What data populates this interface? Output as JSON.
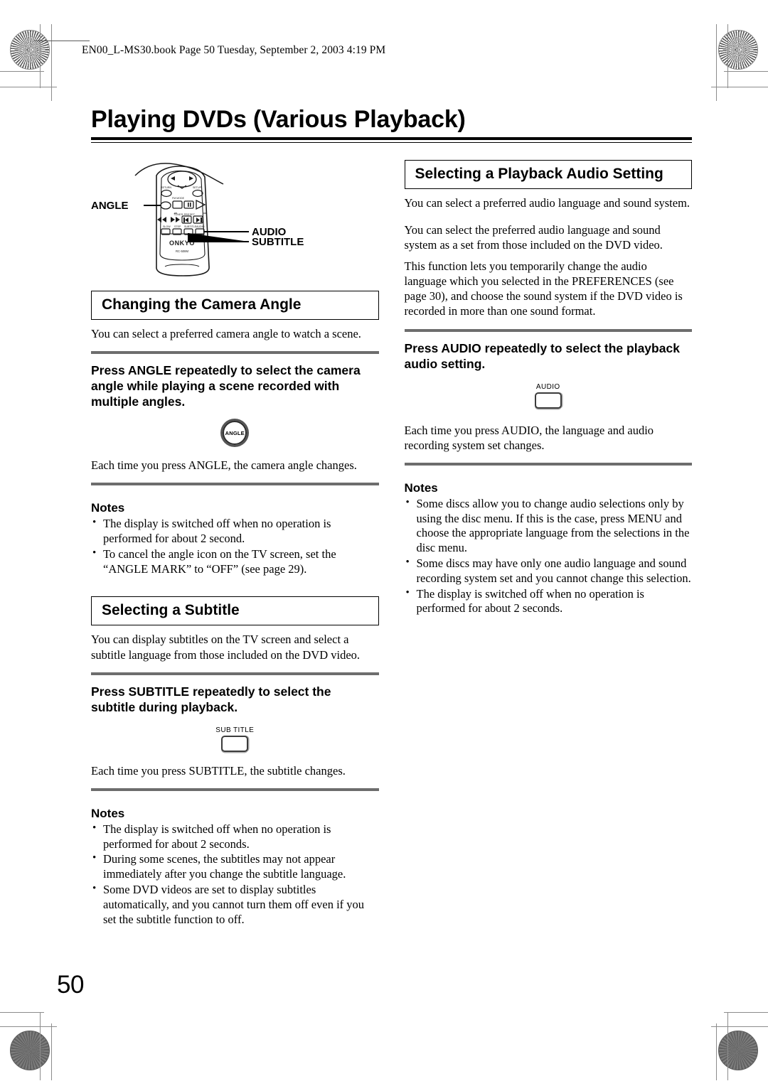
{
  "page": {
    "running_header": "EN00_L-MS30.book  Page 50  Tuesday, September 2, 2003  4:19 PM",
    "title": "Playing DVDs (Various Playback)",
    "page_number": "50"
  },
  "remote_figure": {
    "callout_angle": "ANGLE",
    "callout_audio": "AUDIO",
    "callout_subtitle": "SUBTITLE",
    "brand": "ONKYO",
    "model": "RC-508M",
    "key_labels": {
      "return": "RETURN",
      "setup": "SETUP",
      "fm_mode": "FM MODE",
      "tuner_preset": "TUNER PRESET",
      "slow": "SLOW",
      "step": "STEP",
      "subtitle": "SUBTITLE",
      "audio": "AUDIO"
    }
  },
  "left_column": {
    "angle_section": {
      "heading": "Changing the Camera Angle",
      "intro": "You can select a preferred camera angle to watch a scene.",
      "instruction": "Press ANGLE repeatedly to select the camera angle while playing a scene recorded with multiple angles.",
      "button_icon_label": "ANGLE",
      "result": "Each time you press ANGLE, the camera angle changes.",
      "notes_heading": "Notes",
      "notes": [
        "The display is switched off when no operation is performed for about 2 second.",
        "To cancel the angle icon on the TV screen, set the “ANGLE MARK” to “OFF” (see page 29)."
      ]
    },
    "subtitle_section": {
      "heading": "Selecting a Subtitle",
      "intro": "You can display subtitles on the TV screen and select a subtitle language from those included on the DVD video.",
      "instruction": "Press SUBTITLE repeatedly to select the subtitle during playback.",
      "indicator_label": "SUB TITLE",
      "result": "Each time you press SUBTITLE, the subtitle changes.",
      "notes_heading": "Notes",
      "notes": [
        "The display is switched off when no operation is performed for about 2 seconds.",
        "During some scenes, the subtitles may not appear immediately after you change the subtitle language.",
        "Some DVD videos are set to display subtitles automatically, and you cannot turn them off even if you set the subtitle function to off."
      ]
    }
  },
  "right_column": {
    "audio_section": {
      "heading": "Selecting a Playback Audio Setting",
      "intro": "You can select a preferred audio language and sound system.",
      "paragraph_2": "You can select the preferred audio language and sound system as a set from those included on the DVD video.",
      "paragraph_3": "This function lets you temporarily change the audio language which you selected in the PREFERENCES (see page 30), and choose the sound system if the DVD video is recorded in more than one sound format.",
      "instruction": "Press AUDIO repeatedly to select the playback audio setting.",
      "indicator_label": "AUDIO",
      "result": "Each time you press AUDIO, the language and audio recording system set changes.",
      "notes_heading": "Notes",
      "notes": [
        "Some discs allow you to change audio selections only by using the disc menu. If this is the case, press MENU and choose the appropriate language from the selections in the disc menu.",
        "Some discs may have only one audio language and sound recording system set and you cannot change this selection.",
        "The display is switched off when no operation is performed for about 2 seconds."
      ]
    }
  },
  "colors": {
    "ink": "#000000",
    "rule_gray": "#6d6d6d",
    "registration_gray": "#7a7a7a"
  }
}
